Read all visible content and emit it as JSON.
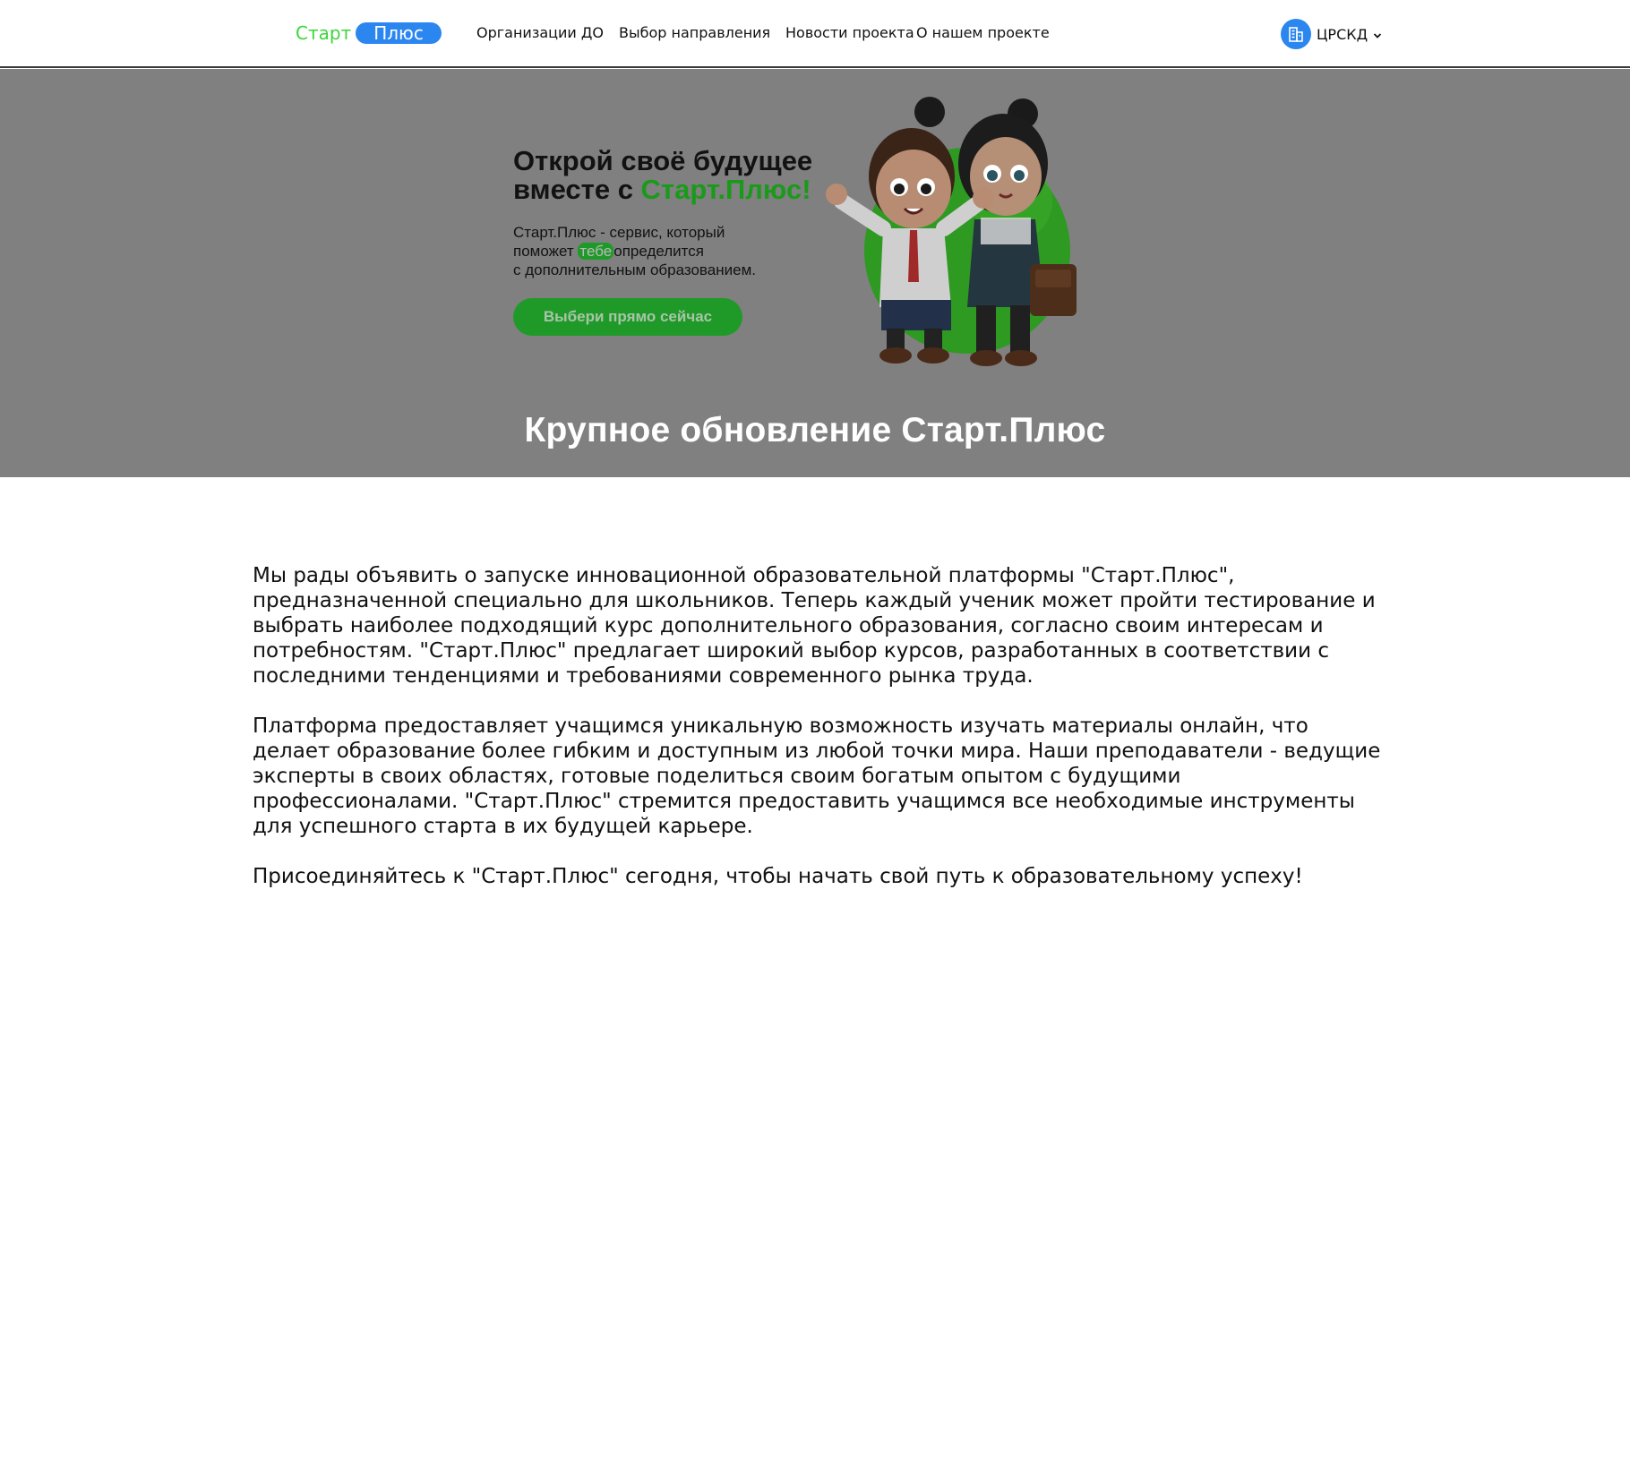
{
  "header": {
    "logo": {
      "start": "Старт",
      "plus": "Плюс"
    },
    "nav": [
      {
        "label": "Организации ДО"
      },
      {
        "label": "Выбор направления"
      },
      {
        "label": "Новости проекта"
      },
      {
        "label": "О нашем проекте"
      }
    ],
    "org": {
      "label": "ЦРСКД",
      "icon": "building-icon"
    }
  },
  "hero": {
    "banner": {
      "title_line1": "Открой своё будущее",
      "title_line2_prefix": "вместе с ",
      "title_line2_accent": "Старт.Плюс!",
      "text_line1": "Старт.Плюс - сервис, который",
      "text_line2_prefix": "поможет ",
      "text_line2_highlight": "тебе",
      "text_line2_suffix": "определится",
      "text_line3": "с дополнительным образованием.",
      "button_label": "Выбери прямо сейчас"
    },
    "title": "Крупное обновление Старт.Плюс",
    "overlay_color": "#808080"
  },
  "article": {
    "paragraphs": [
      "Мы рады объявить о запуске инновационной образовательной платформы \"Старт.Плюс\", предназначенной специально для школьников. Теперь каждый ученик может пройти тестирование и выбрать наиболее подходящий курс дополнительного образования, согласно своим интересам и потребностям. \"Старт.Плюс\" предлагает широкий выбор курсов, разработанных в соответствии с последними тенденциями и требованиями современного рынка труда.",
      "Платформа предоставляет учащимся уникальную возможность изучать материалы онлайн, что делает образование более гибким и доступным из любой точки мира. Наши преподаватели - ведущие эксперты в своих областях, готовые поделиться своим богатым опытом с будущими профессионалами. \"Старт.Плюс\" стремится предоставить учащимся все необходимые инструменты для успешного старта в их будущей карьере.",
      "Присоединяйтесь к \"Старт.Плюс\" сегодня, чтобы начать свой путь к образовательному успеху!"
    ]
  },
  "colors": {
    "brand_green": "#3cd63a",
    "brand_blue": "#2b86f0",
    "button_green": "#1f9a28"
  }
}
